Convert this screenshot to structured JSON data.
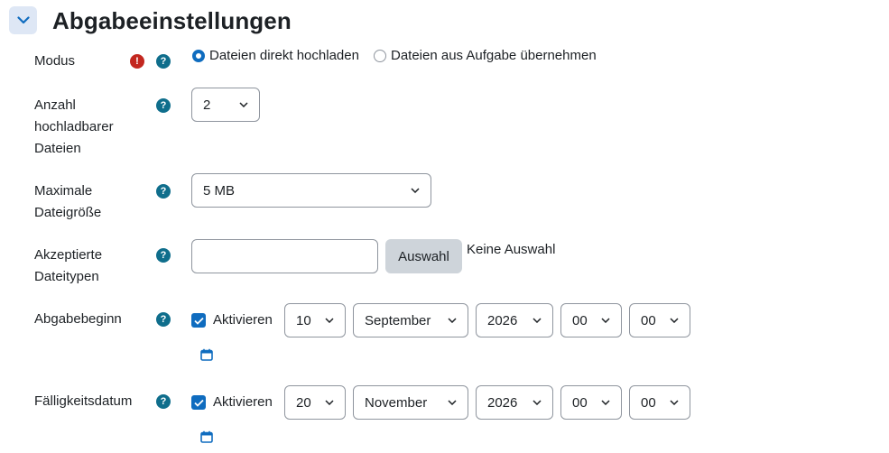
{
  "section": {
    "title": "Abgabeeinstellungen"
  },
  "modus": {
    "label": "Modus",
    "options": [
      {
        "label": "Dateien direkt hochladen",
        "selected": true
      },
      {
        "label": "Dateien aus Aufgabe übernehmen",
        "selected": false
      }
    ]
  },
  "max_files": {
    "label_lines": [
      "Anzahl",
      "hochladbarer",
      "Dateien"
    ],
    "value": "2"
  },
  "max_size": {
    "label_lines": [
      "Maximale",
      "Dateigröße"
    ],
    "value": "5 MB"
  },
  "file_types": {
    "label_lines": [
      "Akzeptierte",
      "Dateitypen"
    ],
    "input_value": "",
    "button_label": "Auswahl",
    "status": "Keine Auswahl"
  },
  "start": {
    "label": "Abgabebeginn",
    "enable_label": "Aktivieren",
    "enabled": true,
    "day": "10",
    "month": "September",
    "year": "2026",
    "hour": "00",
    "minute": "00"
  },
  "due": {
    "label": "Fälligkeitsdatum",
    "enable_label": "Aktivieren",
    "enabled": true,
    "day": "20",
    "month": "November",
    "year": "2026",
    "hour": "00",
    "minute": "00"
  },
  "icons": {
    "collapse": "chevron-down-icon",
    "required": "required-icon",
    "help": "help-icon",
    "calendar": "calendar-icon"
  },
  "colors": {
    "primary": "#0f6cbf",
    "help": "#0f6e8c",
    "required": "#c3271f",
    "collapse_bg": "#dee7f5"
  }
}
